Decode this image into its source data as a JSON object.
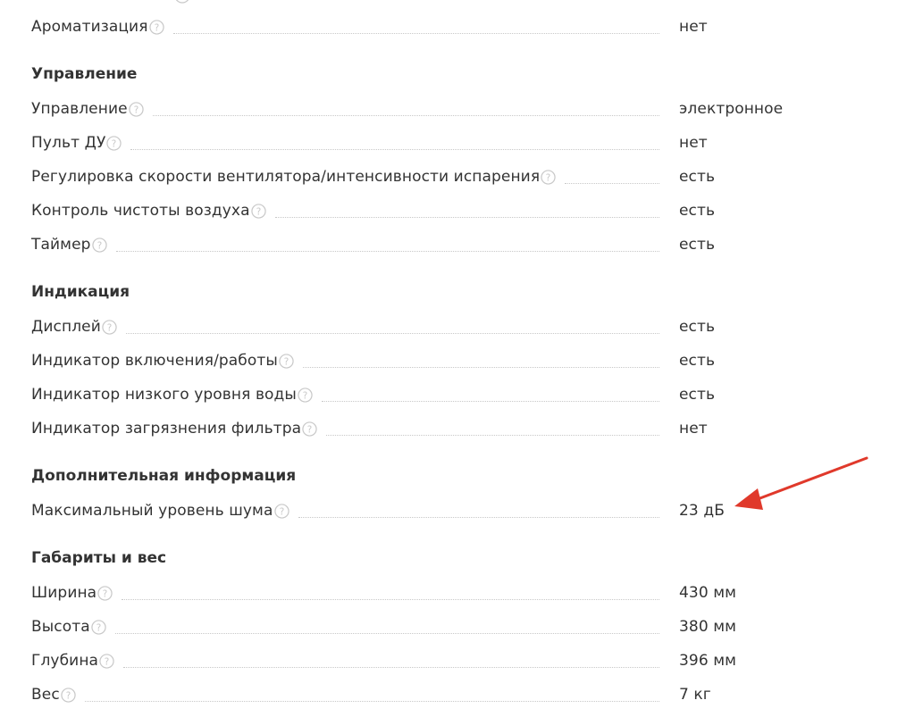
{
  "groups": [
    {
      "title": "",
      "items": [
        {
          "name": "Ароматизация",
          "value": "нет"
        }
      ]
    },
    {
      "title": "Управление",
      "items": [
        {
          "name": "Управление",
          "value": "электронное"
        },
        {
          "name": "Пульт ДУ",
          "value": "нет"
        },
        {
          "name": "Регулировка скорости вентилятора/интенсивности испарения",
          "value": "есть"
        },
        {
          "name": "Контроль чистоты воздуха",
          "value": "есть"
        },
        {
          "name": "Таймер",
          "value": "есть"
        }
      ]
    },
    {
      "title": "Индикация",
      "items": [
        {
          "name": "Дисплей",
          "value": "есть"
        },
        {
          "name": "Индикатор включения/работы",
          "value": "есть"
        },
        {
          "name": "Индикатор низкого уровня воды",
          "value": "есть"
        },
        {
          "name": "Индикатор загрязнения фильтра",
          "value": "нет"
        }
      ]
    },
    {
      "title": "Дополнительная информация",
      "items": [
        {
          "name": "Максимальный уровень шума",
          "value": "23 дБ"
        }
      ]
    },
    {
      "title": "Габариты и вес",
      "items": [
        {
          "name": "Ширина",
          "value": "430 мм"
        },
        {
          "name": "Высота",
          "value": "380 мм"
        },
        {
          "name": "Глубина",
          "value": "396 мм"
        },
        {
          "name": "Вес",
          "value": "7 кг"
        }
      ]
    }
  ],
  "icons": {
    "help": "question-circle-icon",
    "annotation": "red-arrow-icon"
  },
  "colors": {
    "text": "#333333",
    "help_icon": "#c8c8c8",
    "dots": "#c8c8c8",
    "arrow": "#e0392b"
  }
}
